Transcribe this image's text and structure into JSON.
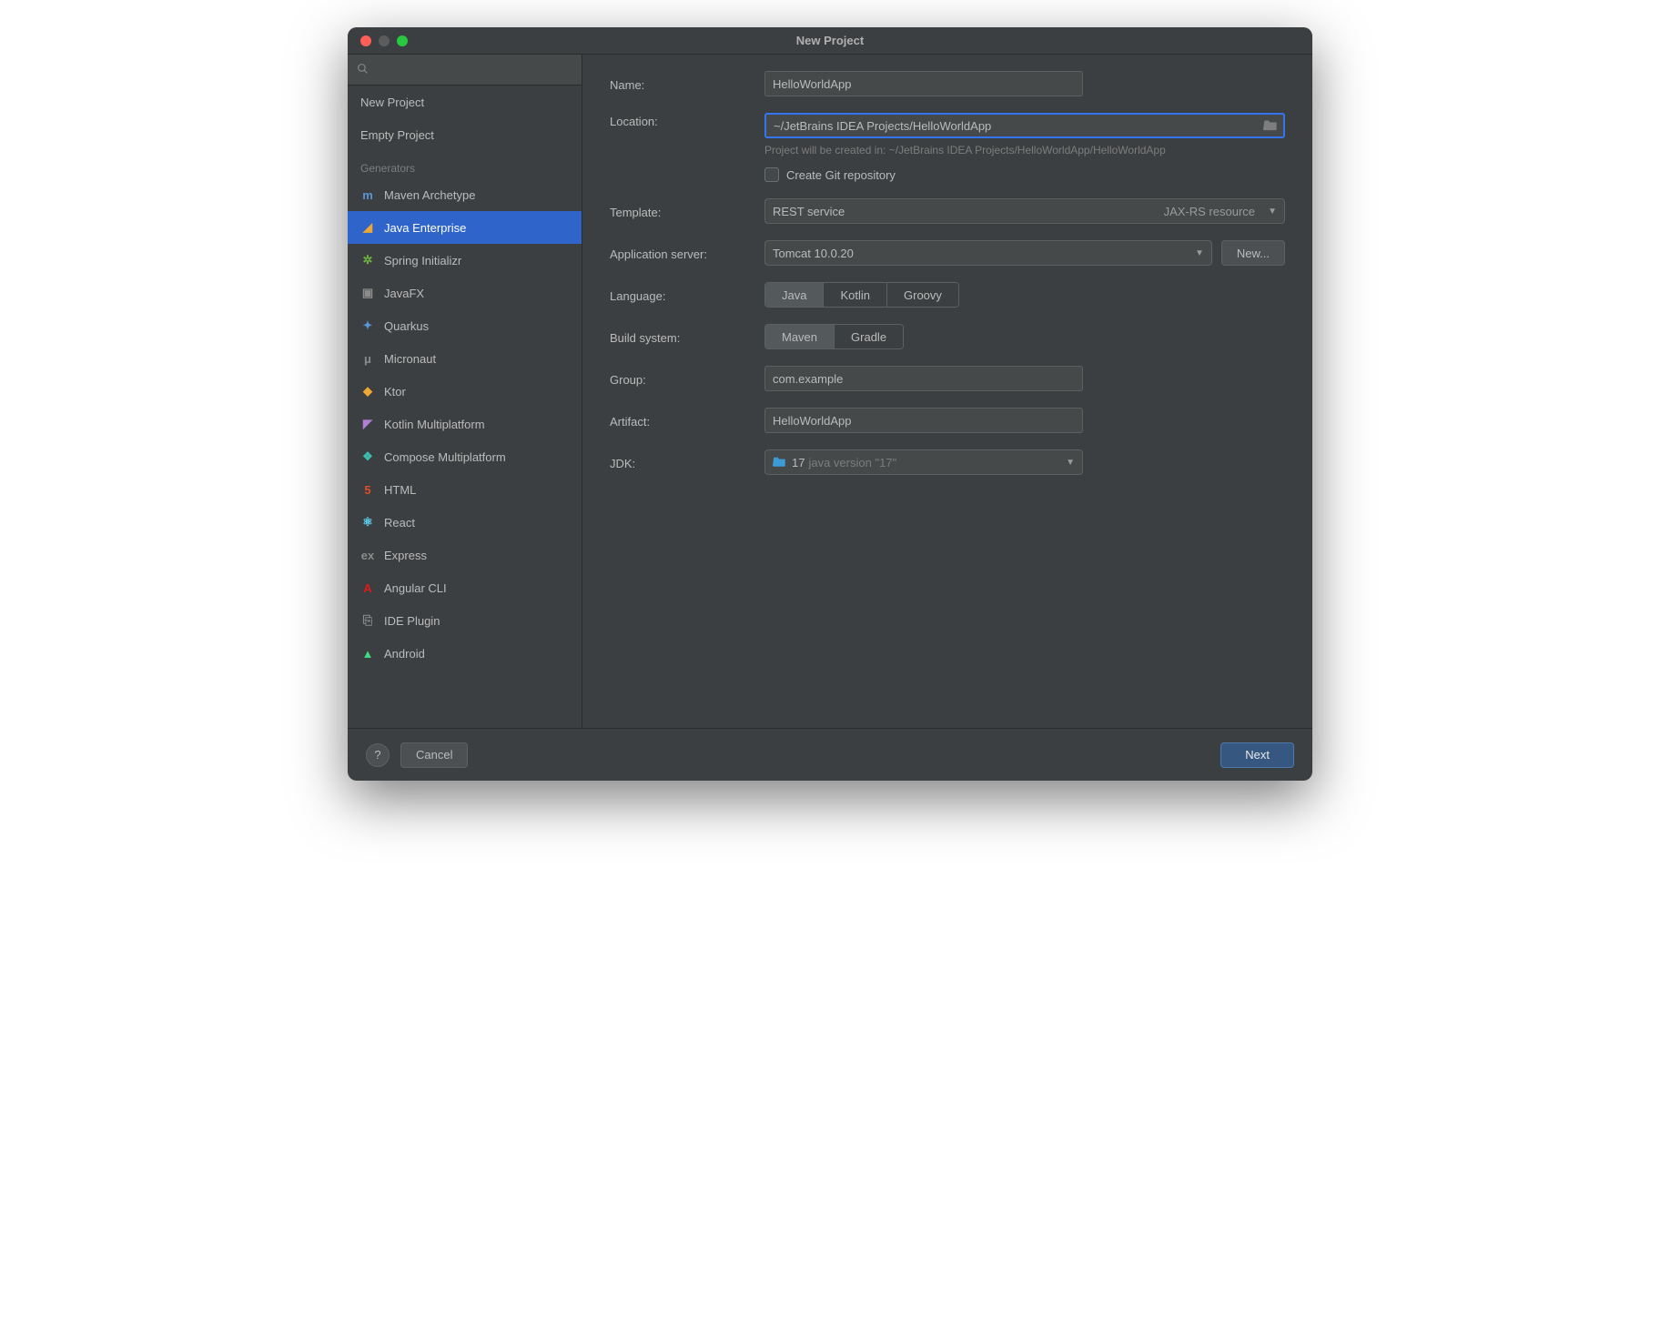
{
  "window": {
    "title": "New Project"
  },
  "sidebar": {
    "search_placeholder": "",
    "items_top": [
      {
        "label": "New Project"
      },
      {
        "label": "Empty Project"
      }
    ],
    "generators_header": "Generators",
    "generators": [
      {
        "label": "Maven Archetype",
        "icon": "m",
        "iconClass": "c-blue"
      },
      {
        "label": "Java Enterprise",
        "icon": "◢",
        "iconClass": "c-orange",
        "selected": true
      },
      {
        "label": "Spring Initializr",
        "icon": "✲",
        "iconClass": "c-green"
      },
      {
        "label": "JavaFX",
        "icon": "▣",
        "iconClass": "c-grey"
      },
      {
        "label": "Quarkus",
        "icon": "✦",
        "iconClass": "c-blue"
      },
      {
        "label": "Micronaut",
        "icon": "μ",
        "iconClass": "c-grey"
      },
      {
        "label": "Ktor",
        "icon": "◆",
        "iconClass": "c-orange"
      },
      {
        "label": "Kotlin Multiplatform",
        "icon": "◤",
        "iconClass": "c-purple"
      },
      {
        "label": "Compose Multiplatform",
        "icon": "❖",
        "iconClass": "c-teal"
      },
      {
        "label": "HTML",
        "icon": "5",
        "iconClass": "c-html"
      },
      {
        "label": "React",
        "icon": "⚛",
        "iconClass": "c-react"
      },
      {
        "label": "Express",
        "icon": "ex",
        "iconClass": "c-grey"
      },
      {
        "label": "Angular CLI",
        "icon": "A",
        "iconClass": "c-red"
      },
      {
        "label": "IDE Plugin",
        "icon": "⎘",
        "iconClass": "c-grey"
      },
      {
        "label": "Android",
        "icon": "▲",
        "iconClass": "c-android"
      }
    ]
  },
  "form": {
    "name_label": "Name:",
    "name_value": "HelloWorldApp",
    "location_label": "Location:",
    "location_value": "~/JetBrains IDEA Projects/HelloWorldApp",
    "location_hint": "Project will be created in: ~/JetBrains IDEA Projects/HelloWorldApp/HelloWorldApp",
    "git_checkbox_label": "Create Git repository",
    "template_label": "Template:",
    "template_value": "REST service",
    "template_secondary": "JAX-RS resource",
    "appserver_label": "Application server:",
    "appserver_value": "Tomcat 10.0.20",
    "appserver_new": "New...",
    "language_label": "Language:",
    "language_options": [
      "Java",
      "Kotlin",
      "Groovy"
    ],
    "language_selected": "Java",
    "buildsys_label": "Build system:",
    "buildsys_options": [
      "Maven",
      "Gradle"
    ],
    "buildsys_selected": "Maven",
    "group_label": "Group:",
    "group_value": "com.example",
    "artifact_label": "Artifact:",
    "artifact_value": "HelloWorldApp",
    "jdk_label": "JDK:",
    "jdk_primary": "17",
    "jdk_secondary": "java version \"17\""
  },
  "footer": {
    "help": "?",
    "cancel": "Cancel",
    "next": "Next"
  }
}
